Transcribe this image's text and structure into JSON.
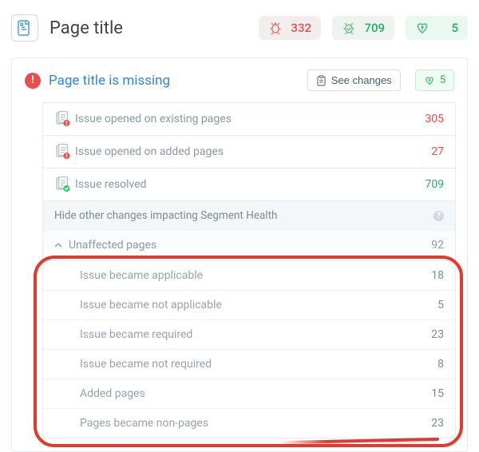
{
  "header": {
    "title": "Page title",
    "bugs_opened": "332",
    "bugs_resolved": "709",
    "health_delta": "5"
  },
  "card": {
    "title": "Page title is missing",
    "see_changes_label": "See changes",
    "health_delta": "5"
  },
  "rows": {
    "opened_existing": {
      "label": "Issue opened on existing pages",
      "count": "305"
    },
    "opened_added": {
      "label": "Issue opened on added pages",
      "count": "27"
    },
    "resolved": {
      "label": "Issue resolved",
      "count": "709"
    }
  },
  "subhead": {
    "label": "Hide other changes impacting Segment Health"
  },
  "group": {
    "label": "Unaffected pages",
    "count": "92"
  },
  "subrows": [
    {
      "label": "Issue became applicable",
      "count": "18"
    },
    {
      "label": "Issue became not applicable",
      "count": "5"
    },
    {
      "label": "Issue became required",
      "count": "23"
    },
    {
      "label": "Issue became not required",
      "count": "8"
    },
    {
      "label": "Added pages",
      "count": "15"
    },
    {
      "label": "Pages became non-pages",
      "count": "23"
    }
  ]
}
